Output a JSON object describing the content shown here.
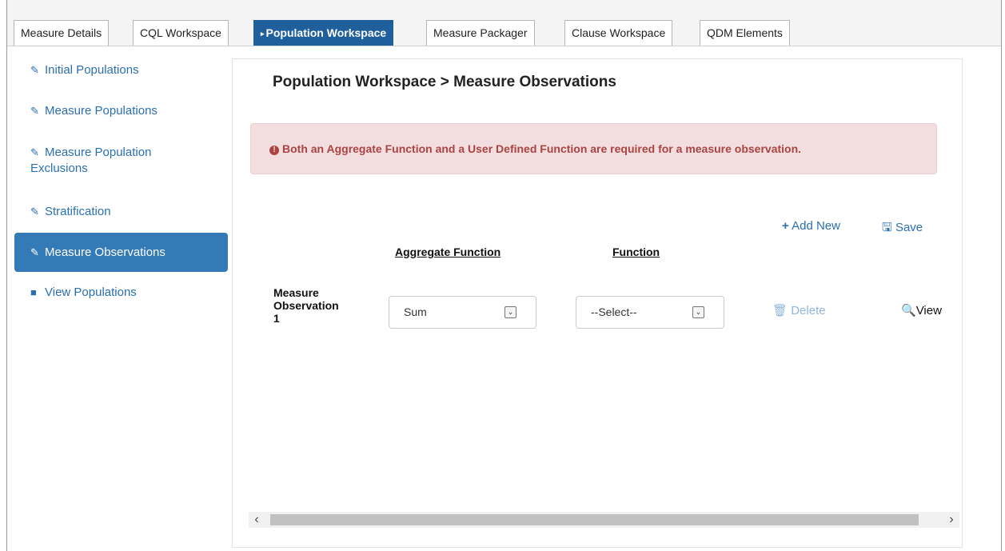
{
  "tabs": [
    {
      "label": "Measure Details"
    },
    {
      "label": "CQL Workspace"
    },
    {
      "label": "Population Workspace",
      "active_marker": "▸"
    },
    {
      "label": "Measure Packager"
    },
    {
      "label": "Clause Workspace"
    },
    {
      "label": "QDM Elements"
    }
  ],
  "sidebar": {
    "items": [
      {
        "label": "Initial Populations",
        "icon": "pencil-icon"
      },
      {
        "label": "Measure Populations",
        "icon": "pencil-icon"
      },
      {
        "label": "Measure Population",
        "label_line2": "Exclusions",
        "icon": "pencil-icon"
      },
      {
        "label": "Stratification",
        "icon": "pencil-icon"
      },
      {
        "label": "Measure Observations",
        "icon": "pencil-icon",
        "active": true
      },
      {
        "label": "View Populations",
        "icon": "book-icon"
      }
    ]
  },
  "main": {
    "title": "Population Workspace > Measure Observations",
    "alert": "Both an Aggregate Function and a User Defined Function are required for a measure observation.",
    "add_new": "Add New",
    "save": "Save",
    "columns": {
      "aggregate": "Aggregate Function",
      "function": "Function"
    },
    "rows": [
      {
        "label_1": "Measure",
        "label_2": "Observation",
        "label_3": "1",
        "aggregate_value": "Sum",
        "function_value": "--Select--",
        "delete": "Delete",
        "view": "View"
      }
    ]
  },
  "colors": {
    "active_tab": "#1f5f9c",
    "link": "#2a6fb0",
    "active_sidebar": "#337ab7",
    "alert_bg": "#f2dede",
    "alert_text": "#a94442"
  }
}
